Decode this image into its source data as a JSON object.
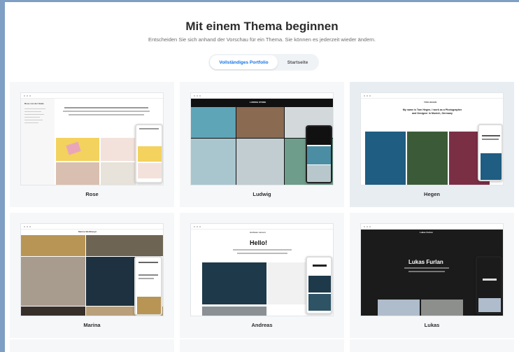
{
  "header": {
    "title": "Mit einem Thema beginnen",
    "subtitle": "Entscheiden Sie sich anhand der Vorschau für ein Thema. Sie können es jederzeit wieder ändern."
  },
  "tabs": [
    {
      "label": "Vollständiges Portfolio",
      "active": true
    },
    {
      "label": "Startseite",
      "active": false
    }
  ],
  "themes": [
    {
      "label": "Rose",
      "selected": false
    },
    {
      "label": "Ludwig",
      "selected": false
    },
    {
      "label": "Hegen",
      "selected": true
    },
    {
      "label": "Marina",
      "selected": false
    },
    {
      "label": "Andreas",
      "selected": false
    },
    {
      "label": "Lukas",
      "selected": false
    }
  ],
  "previews": {
    "rose_name": "Rose von der Scale",
    "ludwig_name": "LUDWIG STORE",
    "hegen_name": "TOM HEGEN",
    "hegen_intro": "My name is Tom Hegen, I work as a Photographer and Designer in Munich, Germany",
    "marina_name": "Marina Weißhaupt",
    "andreas_name": "Andreas Larsen",
    "andreas_hello": "Hello!",
    "lukas_name": "Lukas Furlan"
  },
  "colors": {
    "accent": "#1473e6",
    "card_bg": "#f5f7f9",
    "card_selected_bg": "#e8edf2"
  }
}
